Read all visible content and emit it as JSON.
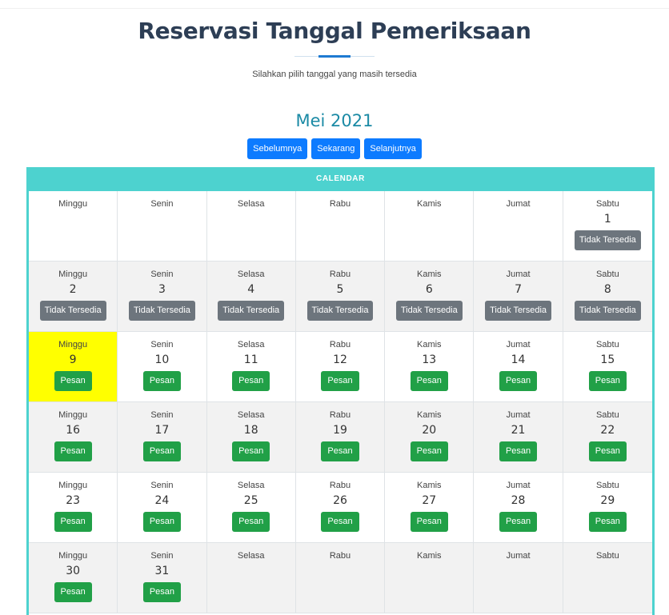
{
  "page": {
    "title": "Reservasi Tanggal Pemeriksaan",
    "subtitle": "Silahkan pilih tanggal yang masih tersedia",
    "month_label": "Mei 2021",
    "nav": {
      "prev_label": "Sebelumnya",
      "today_label": "Sekarang",
      "next_label": "Selanjutnya"
    },
    "calendar_title": "CALENDAR"
  },
  "calendar": {
    "weeks": [
      [
        {
          "day": "Minggu",
          "date": "",
          "button": ""
        },
        {
          "day": "Senin",
          "date": "",
          "button": ""
        },
        {
          "day": "Selasa",
          "date": "",
          "button": ""
        },
        {
          "day": "Rabu",
          "date": "",
          "button": ""
        },
        {
          "day": "Kamis",
          "date": "",
          "button": ""
        },
        {
          "day": "Jumat",
          "date": "",
          "button": ""
        },
        {
          "day": "Sabtu",
          "date": "1",
          "button": "Tidak Tersedia"
        }
      ],
      [
        {
          "day": "Minggu",
          "date": "2",
          "button": "Tidak Tersedia"
        },
        {
          "day": "Senin",
          "date": "3",
          "button": "Tidak Tersedia"
        },
        {
          "day": "Selasa",
          "date": "4",
          "button": "Tidak Tersedia"
        },
        {
          "day": "Rabu",
          "date": "5",
          "button": "Tidak Tersedia"
        },
        {
          "day": "Kamis",
          "date": "6",
          "button": "Tidak Tersedia"
        },
        {
          "day": "Jumat",
          "date": "7",
          "button": "Tidak Tersedia"
        },
        {
          "day": "Sabtu",
          "date": "8",
          "button": "Tidak Tersedia"
        }
      ],
      [
        {
          "day": "Minggu",
          "date": "9",
          "button": "Pesan",
          "today": true
        },
        {
          "day": "Senin",
          "date": "10",
          "button": "Pesan"
        },
        {
          "day": "Selasa",
          "date": "11",
          "button": "Pesan"
        },
        {
          "day": "Rabu",
          "date": "12",
          "button": "Pesan"
        },
        {
          "day": "Kamis",
          "date": "13",
          "button": "Pesan"
        },
        {
          "day": "Jumat",
          "date": "14",
          "button": "Pesan"
        },
        {
          "day": "Sabtu",
          "date": "15",
          "button": "Pesan"
        }
      ],
      [
        {
          "day": "Minggu",
          "date": "16",
          "button": "Pesan"
        },
        {
          "day": "Senin",
          "date": "17",
          "button": "Pesan"
        },
        {
          "day": "Selasa",
          "date": "18",
          "button": "Pesan"
        },
        {
          "day": "Rabu",
          "date": "19",
          "button": "Pesan"
        },
        {
          "day": "Kamis",
          "date": "20",
          "button": "Pesan"
        },
        {
          "day": "Jumat",
          "date": "21",
          "button": "Pesan"
        },
        {
          "day": "Sabtu",
          "date": "22",
          "button": "Pesan"
        }
      ],
      [
        {
          "day": "Minggu",
          "date": "23",
          "button": "Pesan"
        },
        {
          "day": "Senin",
          "date": "24",
          "button": "Pesan"
        },
        {
          "day": "Selasa",
          "date": "25",
          "button": "Pesan"
        },
        {
          "day": "Rabu",
          "date": "26",
          "button": "Pesan"
        },
        {
          "day": "Kamis",
          "date": "27",
          "button": "Pesan"
        },
        {
          "day": "Jumat",
          "date": "28",
          "button": "Pesan"
        },
        {
          "day": "Sabtu",
          "date": "29",
          "button": "Pesan"
        }
      ],
      [
        {
          "day": "Minggu",
          "date": "30",
          "button": "Pesan"
        },
        {
          "day": "Senin",
          "date": "31",
          "button": "Pesan"
        },
        {
          "day": "Selasa",
          "date": "",
          "button": ""
        },
        {
          "day": "Rabu",
          "date": "",
          "button": ""
        },
        {
          "day": "Kamis",
          "date": "",
          "button": ""
        },
        {
          "day": "Jumat",
          "date": "",
          "button": ""
        },
        {
          "day": "Sabtu",
          "date": "",
          "button": ""
        }
      ]
    ]
  },
  "colors": {
    "title": "#2d3e55",
    "accent_teal": "#4dd2cf",
    "month_text": "#1b8aa5",
    "nav_button": "#0d7bff",
    "book_button": "#21a047",
    "unavailable_button": "#6d757d",
    "today_highlight": "#ffff00"
  }
}
